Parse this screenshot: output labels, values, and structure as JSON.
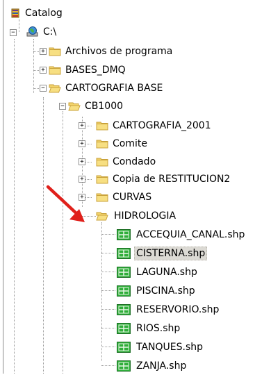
{
  "tree": {
    "root": {
      "label": "Catalog",
      "icon": "catalog-icon"
    },
    "drive": {
      "label": "C:\\",
      "icon": "drive-globe-icon"
    },
    "folders_level1": [
      {
        "label": "Archivos de programa",
        "expanded": false
      },
      {
        "label": "BASES_DMQ",
        "expanded": false
      },
      {
        "label": "CARTOGRAFIA BASE",
        "expanded": true
      }
    ],
    "cb1000": {
      "label": "CB1000",
      "expanded": true
    },
    "folders_level3": [
      {
        "label": "CARTOGRAFIA_2001",
        "expanded": false
      },
      {
        "label": "Comite",
        "expanded": false
      },
      {
        "label": "Condado",
        "expanded": false
      },
      {
        "label": "Copia de RESTITUCION2",
        "expanded": false
      },
      {
        "label": "CURVAS",
        "expanded": false
      },
      {
        "label": "HIDROLOGIA",
        "expanded": true
      }
    ],
    "shapefiles": [
      {
        "label": "ACCEQUIA_CANAL.shp",
        "selected": false
      },
      {
        "label": "CISTERNA.shp",
        "selected": true
      },
      {
        "label": "LAGUNA.shp",
        "selected": false
      },
      {
        "label": "PISCINA.shp",
        "selected": false
      },
      {
        "label": "RESERVORIO.shp",
        "selected": false
      },
      {
        "label": "RIOS.shp",
        "selected": false
      },
      {
        "label": "TANQUES.shp",
        "selected": false
      },
      {
        "label": "ZANJA.shp",
        "selected": false
      }
    ]
  },
  "colors": {
    "folder": "#f2d36b",
    "folder_dark": "#c9a23a",
    "shapefile_green": "#2fae3a",
    "arrow_red": "#e0201b",
    "selection": "#dcdad4"
  }
}
